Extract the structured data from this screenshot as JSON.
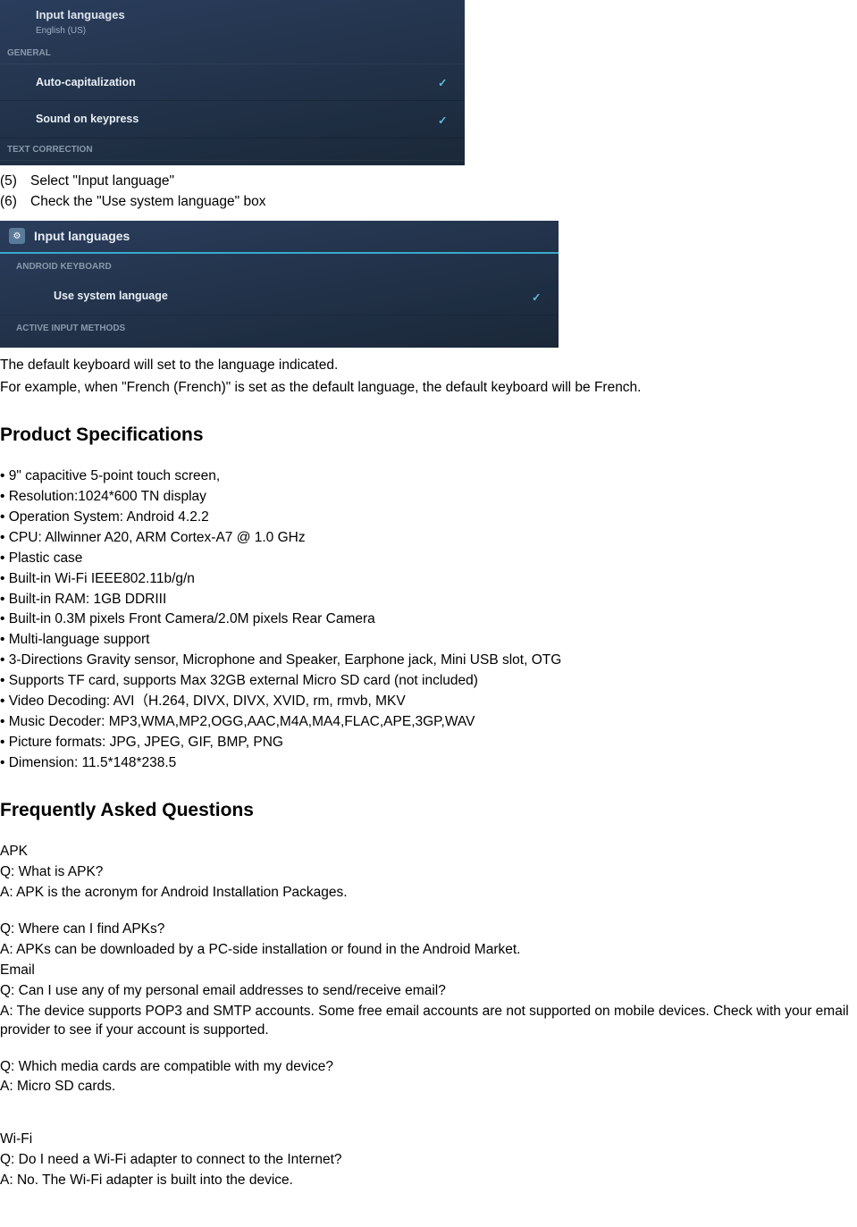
{
  "screenshot1": {
    "row1_title": "Input languages",
    "row1_sub": "English (US)",
    "section1": "GENERAL",
    "item1": "Auto-capitalization",
    "item2": "Sound on keypress",
    "section2": "TEXT CORRECTION"
  },
  "steps": {
    "s5_num": "(5)",
    "s5_text": "Select \"Input language\"",
    "s6_num": "(6)",
    "s6_text": "Check the \"Use system language\" box"
  },
  "screenshot2": {
    "header_title": "Input languages",
    "section1": "ANDROID KEYBOARD",
    "item1": "Use system language",
    "section2": "ACTIVE INPUT METHODS"
  },
  "para1": "The default keyboard will set to the language indicated.",
  "para2": "For example, when \"French (French)\" is set as the default language, the default keyboard will be French.",
  "h_spec": "Product Specifications",
  "specs": [
    "• 9\" capacitive 5-point touch screen,",
    "• Resolution:1024*600 TN display",
    "• Operation System: Android 4.2.2",
    "• CPU: Allwinner A20, ARM Cortex-A7 @ 1.0 GHz",
    "• Plastic case",
    "• Built-in Wi-Fi IEEE802.11b/g/n",
    "• Built-in RAM: 1GB DDRIII",
    "• Built-in 0.3M pixels Front Camera/2.0M pixels Rear Camera",
    "• Multi-language support",
    "• 3-Directions Gravity sensor, Microphone and Speaker, Earphone jack, Mini USB slot, OTG",
    "• Supports TF card, supports Max 32GB external Micro SD card (not included)",
    "• Video Decoding: AVI（H.264, DIVX, DIVX, XVID, rm, rmvb, MKV",
    "• Music Decoder: MP3,WMA,MP2,OGG,AAC,M4A,MA4,FLAC,APE,3GP,WAV",
    "• Picture formats: JPG, JPEG, GIF, BMP, PNG",
    "• Dimension: 11.5*148*238.5"
  ],
  "h_faq": "Frequently Asked Questions",
  "faq": {
    "apk_h": "APK",
    "apk_q1": "Q: What is APK?",
    "apk_a1": "A: APK is the acronym for Android Installation Packages.",
    "apk_q2": "Q: Where can I find APKs?",
    "apk_a2": "A: APKs can be downloaded by a PC-side installation or found in the Android Market.",
    "email_h": "Email",
    "email_q1": "Q: Can I use any of my personal email addresses to send/receive email?",
    "email_a1": "A: The device supports POP3 and SMTP accounts. Some free email accounts are not supported on mobile devices. Check with your email provider to see if your account is supported.",
    "media_q": "Q: Which media cards are compatible with my device?",
    "media_a": "A: Micro SD cards.",
    "wifi_h": "Wi-Fi",
    "wifi_q": "Q: Do I need a Wi-Fi adapter to connect to the Internet?",
    "wifi_a": "A: No. The Wi-Fi adapter is built into the device."
  }
}
